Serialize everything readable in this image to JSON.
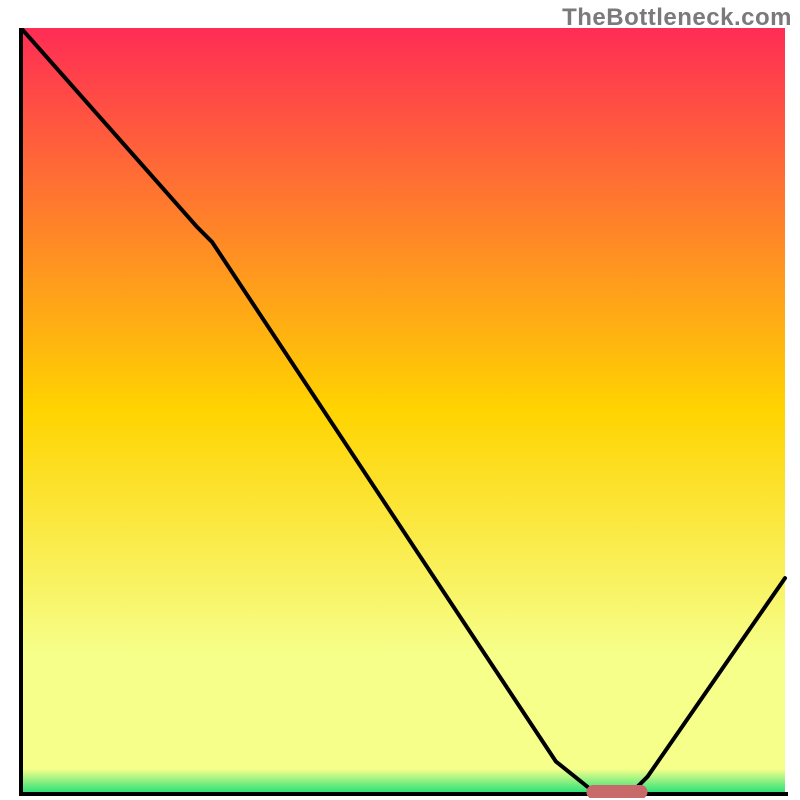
{
  "watermark": "TheBottleneck.com",
  "colors": {
    "gradient_top": "#ff2c55",
    "gradient_mid": "#ffd400",
    "gradient_low": "#f6ff8a",
    "gradient_green": "#2fe37a",
    "curve": "#000000",
    "marker": "#c86a6a",
    "axis": "#000000"
  },
  "chart_data": {
    "type": "line",
    "title": "",
    "xlabel": "",
    "ylabel": "",
    "xlim": [
      0,
      100
    ],
    "ylim": [
      0,
      100
    ],
    "x": [
      0,
      23,
      25,
      70,
      75,
      80,
      82,
      100
    ],
    "values": [
      100,
      74,
      72,
      4,
      0,
      0,
      2,
      28
    ],
    "marker": {
      "x_start": 74,
      "x_end": 82,
      "y": 0
    },
    "note": "V-shaped bottleneck curve over red→yellow→green vertical gradient; minimum (optimal) near x≈77."
  }
}
